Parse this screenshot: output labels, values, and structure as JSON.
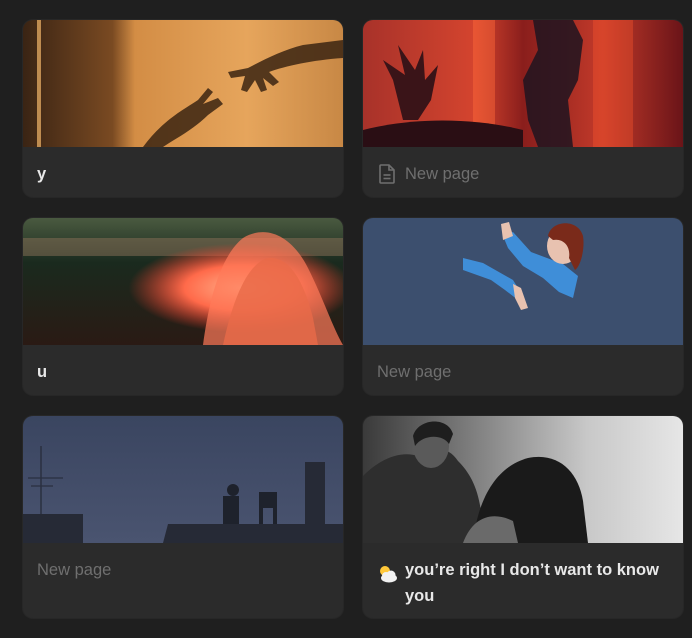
{
  "gallery": {
    "cards": [
      {
        "title": "y",
        "placeholder": false,
        "icon": null
      },
      {
        "title": "New page",
        "placeholder": true,
        "icon": "page-icon"
      },
      {
        "title": "u",
        "placeholder": false,
        "icon": null
      },
      {
        "title": "New page",
        "placeholder": true,
        "icon": null
      },
      {
        "title": "New page",
        "placeholder": true,
        "icon": null
      },
      {
        "title": "you’re right I don’t want to know you",
        "placeholder": false,
        "icon": "sun-behind-cloud-icon"
      }
    ]
  },
  "colors": {
    "background": "#1f1f1f",
    "card": "#2b2b2b",
    "title": "#e8e8e8",
    "placeholder": "#6f6f6f"
  }
}
